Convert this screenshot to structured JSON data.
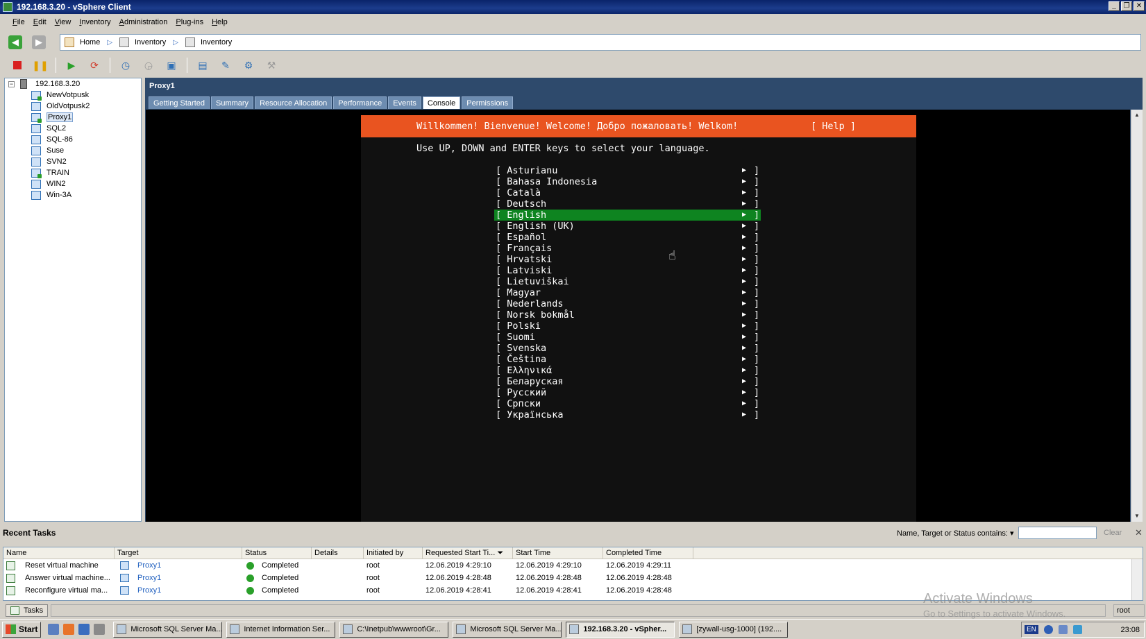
{
  "window": {
    "title": "192.168.3.20 - vSphere Client"
  },
  "menu": [
    "File",
    "Edit",
    "View",
    "Inventory",
    "Administration",
    "Plug-ins",
    "Help"
  ],
  "breadcrumb": {
    "home": "Home",
    "inventory1": "Inventory",
    "inventory2": "Inventory"
  },
  "tree": {
    "host": "192.168.3.20",
    "vms": [
      {
        "name": "NewVotpusk",
        "on": true
      },
      {
        "name": "OldVotpusk2",
        "on": false
      },
      {
        "name": "Proxy1",
        "on": true,
        "selected": true
      },
      {
        "name": "SQL2",
        "on": false
      },
      {
        "name": "SQL-86",
        "on": false
      },
      {
        "name": "Suse",
        "on": false
      },
      {
        "name": "SVN2",
        "on": false
      },
      {
        "name": "TRAIN",
        "on": true
      },
      {
        "name": "WIN2",
        "on": false
      },
      {
        "name": "Win-3A",
        "on": false
      }
    ]
  },
  "panel": {
    "title": "Proxy1",
    "tabs": [
      "Getting Started",
      "Summary",
      "Resource Allocation",
      "Performance",
      "Events",
      "Console",
      "Permissions"
    ],
    "active_tab": "Console"
  },
  "console": {
    "header": "Willkommen! Bienvenue! Welcome! Добро пожаловать! Welkom!",
    "help": "[ Help ]",
    "instruction": "Use UP, DOWN and ENTER keys to select your language.",
    "languages": [
      "Asturianu",
      "Bahasa Indonesia",
      "Català",
      "Deutsch",
      "English",
      "English (UK)",
      "Español",
      "Français",
      "Hrvatski",
      "Latviski",
      "Lietuviškai",
      "Magyar",
      "Nederlands",
      "Norsk bokmål",
      "Polski",
      "Suomi",
      "Svenska",
      "Čeština",
      "Ελληνικά",
      "Беларуская",
      "Русский",
      "Српски",
      "Українська"
    ],
    "selected_language": "English",
    "colors": {
      "header": "#e95420",
      "selection": "#0e8420"
    }
  },
  "tasks": {
    "heading": "Recent Tasks",
    "filter_label": "Name, Target or Status contains: ▾",
    "clear": "Clear",
    "columns": [
      "Name",
      "Target",
      "Status",
      "Details",
      "Initiated by",
      "Requested Start Ti... ⏷",
      "Start Time",
      "Completed Time"
    ],
    "rows": [
      {
        "name": "Reset virtual machine",
        "target": "Proxy1",
        "status": "Completed",
        "details": "",
        "initiated_by": "root",
        "requested": "12.06.2019 4:29:10",
        "start": "12.06.2019 4:29:10",
        "completed": "12.06.2019 4:29:11"
      },
      {
        "name": "Answer virtual machine...",
        "target": "Proxy1",
        "status": "Completed",
        "details": "",
        "initiated_by": "root",
        "requested": "12.06.2019 4:28:48",
        "start": "12.06.2019 4:28:48",
        "completed": "12.06.2019 4:28:48"
      },
      {
        "name": "Reconfigure virtual ma...",
        "target": "Proxy1",
        "status": "Completed",
        "details": "",
        "initiated_by": "root",
        "requested": "12.06.2019 4:28:41",
        "start": "12.06.2019 4:28:41",
        "completed": "12.06.2019 4:28:48"
      }
    ]
  },
  "statusbar": {
    "tasks_tab": "Tasks",
    "user": "root"
  },
  "watermark": {
    "line1": "Activate Windows",
    "line2": "Go to Settings to activate Windows."
  },
  "taskbar": {
    "start": "Start",
    "items": [
      {
        "label": "Microsoft SQL Server Ma...",
        "active": false
      },
      {
        "label": "Internet Information Ser...",
        "active": false
      },
      {
        "label": "C:\\Inetpub\\wwwroot\\Gr...",
        "active": false
      },
      {
        "label": "Microsoft SQL Server Ma...",
        "active": false
      },
      {
        "label": "192.168.3.20 - vSpher...",
        "active": true
      },
      {
        "label": "[zywall-usg-1000] (192....",
        "active": false
      }
    ],
    "lang": "EN",
    "clock": "23:08"
  }
}
